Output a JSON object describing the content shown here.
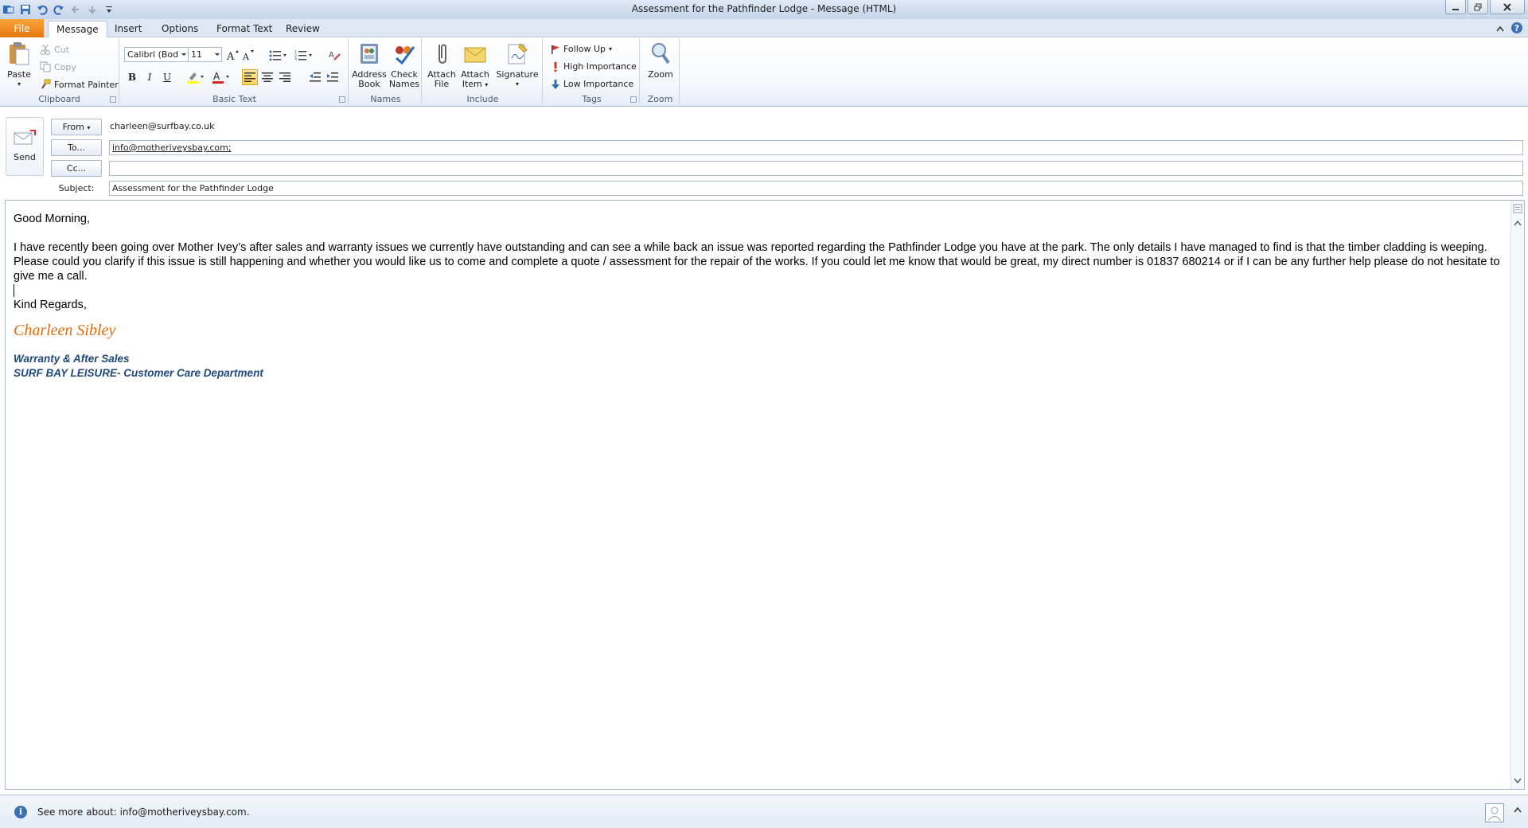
{
  "window": {
    "title": "Assessment for the Pathfinder Lodge  -  Message (HTML)"
  },
  "tabs": [
    {
      "label": "File"
    },
    {
      "label": "Message"
    },
    {
      "label": "Insert"
    },
    {
      "label": "Options"
    },
    {
      "label": "Format Text"
    },
    {
      "label": "Review"
    }
  ],
  "ribbon": {
    "clipboard": {
      "label": "Clipboard",
      "paste": "Paste",
      "cut": "Cut",
      "copy": "Copy",
      "format_painter": "Format Painter"
    },
    "basic_text": {
      "label": "Basic Text",
      "font": "Calibri (Bod",
      "size": "11",
      "bold": "B",
      "italic": "I",
      "underline": "U"
    },
    "names": {
      "label": "Names",
      "address_book": "Address\nBook",
      "address_book_l1": "Address",
      "address_book_l2": "Book",
      "check_l1": "Check",
      "check_l2": "Names"
    },
    "include": {
      "label": "Include",
      "attach_file_l1": "Attach",
      "attach_file_l2": "File",
      "attach_item_l1": "Attach",
      "attach_item_l2": "Item",
      "signature": "Signature"
    },
    "tags": {
      "label": "Tags",
      "follow_up": "Follow Up",
      "high": "High Importance",
      "low": "Low Importance"
    },
    "zoom": {
      "label": "Zoom",
      "zoom": "Zoom"
    }
  },
  "header": {
    "send": "Send",
    "from_label": "From",
    "from_value": "charleen@surfbay.co.uk",
    "to_label": "To...",
    "to_value": "info@motheriveysbay.com;",
    "cc_label": "Cc...",
    "cc_value": "",
    "subject_label": "Subject:",
    "subject_value": "Assessment for the Pathfinder Lodge"
  },
  "body": {
    "greeting": "Good Morning,",
    "paragraph": "I have recently been going over Mother Ivey’s after sales and warranty issues we currently have outstanding and can see a while back an issue was reported regarding the Pathfinder Lodge you have at the park.  The only details I have managed to find is that the timber cladding is weeping.  Please could you clarify if this issue is still happening and whether you would like us to come and complete a quote / assessment for the repair of the works.  If you could let me know that would be great, my direct number is 01837 680214 or if I can be any further help please do not hesitate to give me a call.",
    "closing": "Kind Regards,",
    "signature_name": "Charleen Sibley",
    "signature_title": "Warranty & After Sales",
    "signature_dept": "SURF BAY LEISURE- Customer Care Department"
  },
  "people_bar": {
    "info_icon": "i",
    "text": "See more about: info@motheriveysbay.com."
  },
  "colors": {
    "file_tab": "#e87710",
    "signature_name": "#e36c0a",
    "signature_lines": "#1f497d"
  }
}
